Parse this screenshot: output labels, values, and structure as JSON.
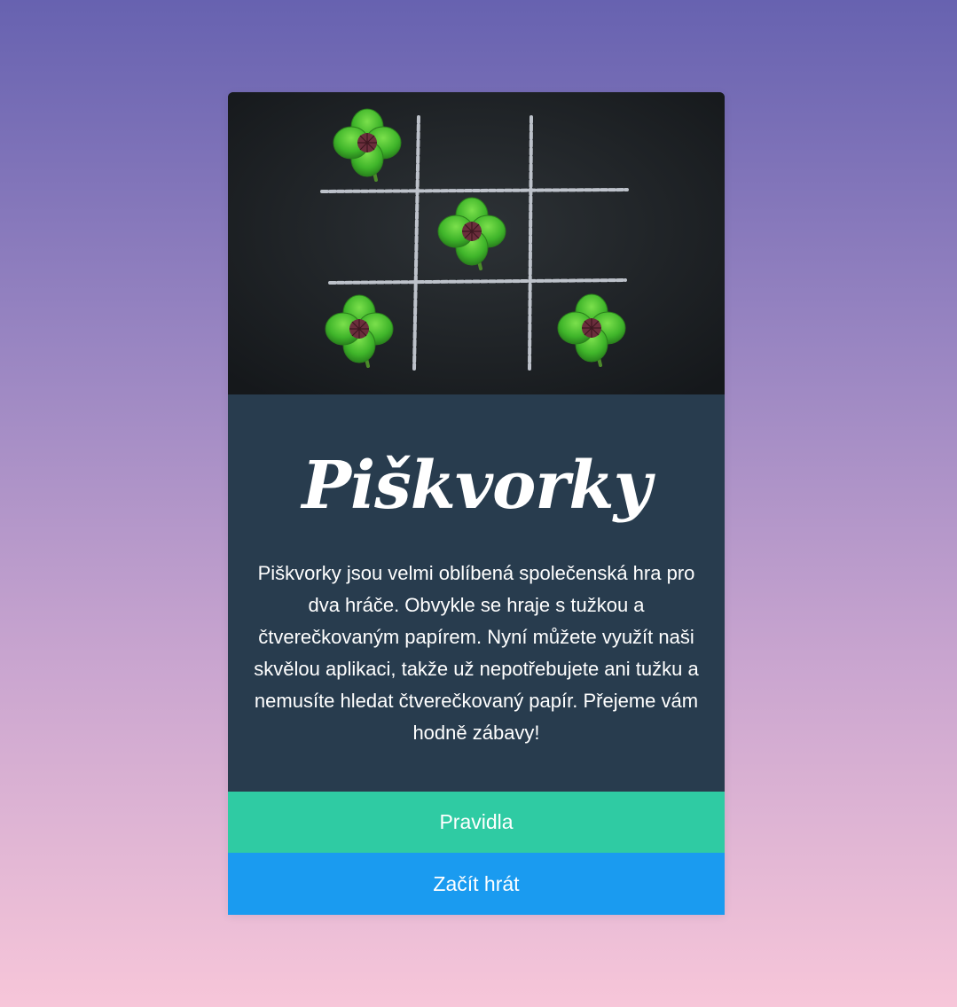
{
  "app": {
    "title": "Piškvorky",
    "description": "Piškvorky jsou velmi oblíbená společenská hra pro dva hráče. Obvykle se hraje s tužkou a čtverečkovaným papírem. Nyní můžete využít naši skvělou aplikaci, takže už nepotřebujete ani tužku a nemusíte hledat čtverečkovaný papír. Přejeme vám hodně zábavy!"
  },
  "hero": {
    "icon": "tic-tac-toe-clover-image",
    "colors": {
      "board": "#1f2326",
      "chalk": "#d8dde6",
      "leaf": "#3fb52a",
      "leaf_dark": "#2b7f1d",
      "center": "#6b2e3c"
    }
  },
  "buttons": {
    "rules_label": "Pravidla",
    "start_label": "Začít hrát"
  },
  "colors": {
    "card_bg": "#283c4e",
    "rules_bg": "#2fcba3",
    "start_bg": "#1a9bf0",
    "text": "#ffffff"
  }
}
